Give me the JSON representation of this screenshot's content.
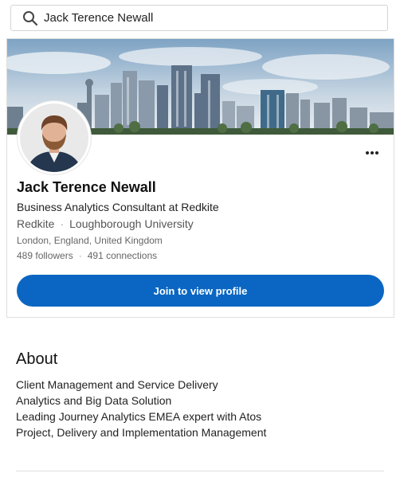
{
  "search": {
    "query": "Jack Terence Newall",
    "icon": "search-icon"
  },
  "profile": {
    "name": "Jack Terence Newall",
    "headline": "Business Analytics Consultant at Redkite",
    "company": "Redkite",
    "school": "Loughborough University",
    "location": "London, England, United Kingdom",
    "followers": "489 followers",
    "connections": "491 connections",
    "more_icon": "more-options-icon",
    "join_button": "Join to view profile",
    "accent_color": "#0a66c2"
  },
  "about": {
    "title": "About",
    "lines": [
      "Client Management and Service Delivery",
      "Analytics and Big Data Solution",
      "Leading Journey Analytics EMEA expert with Atos",
      "Project, Delivery and Implementation Management"
    ]
  }
}
